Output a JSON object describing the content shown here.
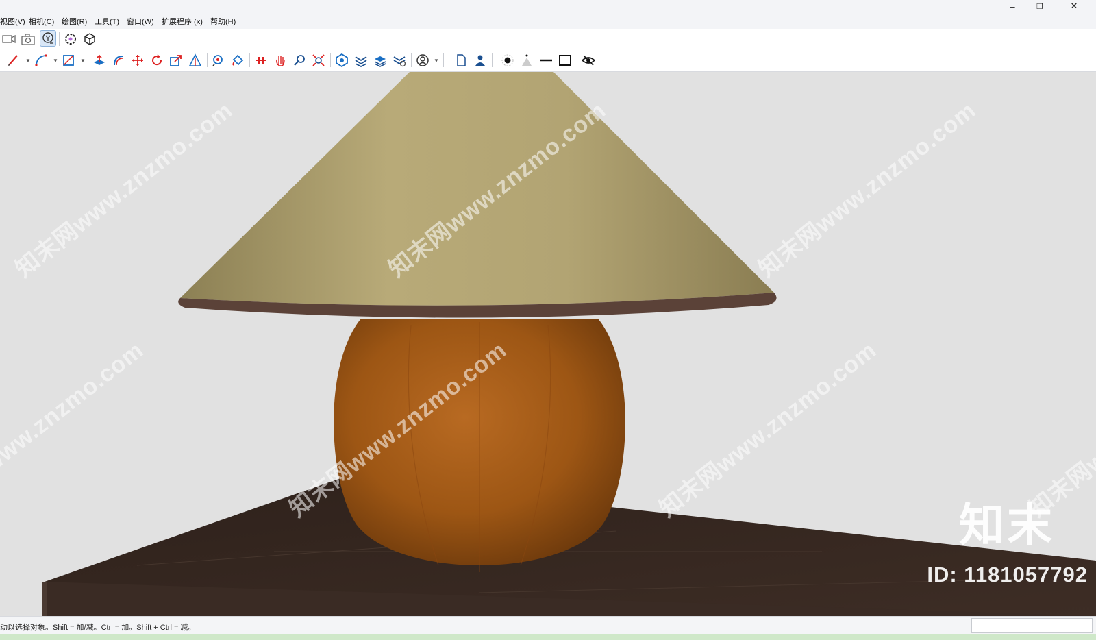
{
  "window": {
    "controls": {
      "minimize": "–",
      "restore": "❐",
      "close": "✕"
    }
  },
  "menubar": {
    "items": [
      "视图(V)",
      "相机(C)",
      "绘图(R)",
      "工具(T)",
      "窗口(W)",
      "扩展程序 (x)",
      "帮助(H)"
    ]
  },
  "toolbar": {
    "row1_icons": [
      "video-camera-icon",
      "photo-camera-icon",
      "orbit-select-icon",
      "gear-flower-icon",
      "box-3d-icon"
    ],
    "row2_icons": [
      "pencil-icon",
      "arc-icon",
      "rectangle-icon",
      "push-pull-icon",
      "follow-me-icon",
      "move-icon",
      "rotate-icon",
      "scale-icon",
      "offset-icon",
      "tape-measure-icon",
      "paint-bucket-icon",
      "walk-icon",
      "pan-hand-icon",
      "zoom-icon",
      "zoom-extents-icon",
      "solid-tools-icon",
      "layers-icon",
      "stack-icon",
      "components-icon",
      "user-circle-icon",
      "page-icon",
      "person-icon",
      "dot-icon",
      "cone-icon",
      "line-icon",
      "square-icon",
      "hide-eye-icon"
    ]
  },
  "viewport": {
    "background_color": "#e1e1e1",
    "watermark_text": "知末网www.znzmo.com",
    "logo_text": "知末",
    "id_text": "ID: 1181057792"
  },
  "statusbar": {
    "hint": "动以选择对象。Shift = 加/减。Ctrl = 加。Shift + Ctrl = 减。"
  },
  "colors": {
    "shade": "#b3a474",
    "shade_rim": "#5b4238",
    "base": "#a45a17",
    "table": "#3a2a22",
    "accent": "#1a6fc4"
  }
}
